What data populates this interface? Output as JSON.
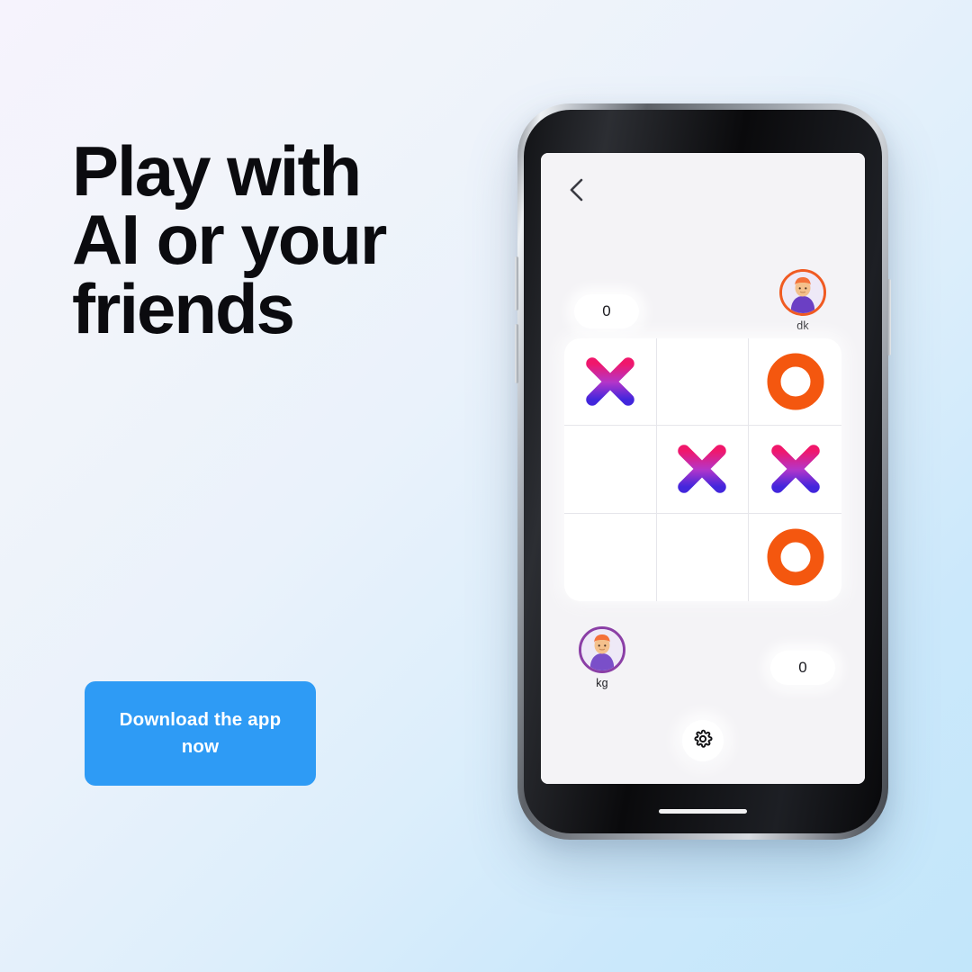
{
  "promo": {
    "headline": "Play with\nAI or your\nfriends",
    "cta_label": "Download the app now",
    "cta_color": "#2e9bf5",
    "background_from": "#f6f3fd",
    "background_to": "#c2e6fa"
  },
  "app": {
    "back_icon": "chevron-left-icon",
    "settings_icon": "gear-icon",
    "screen_background": "#f4f3f6",
    "mark_x_gradient_from": "#f0176b",
    "mark_x_gradient_to": "#4226dc",
    "mark_o_color": "#f4570f",
    "players": {
      "top": {
        "name": "dk",
        "score": "0",
        "ring_color": "#f05a22",
        "avatar_icon": "avatar-orange-hair-icon"
      },
      "bottom": {
        "name": "kg",
        "score": "0",
        "ring_color": "#8b3fa6",
        "avatar_icon": "avatar-orange-hair-icon"
      }
    },
    "board": {
      "cells": [
        {
          "mark": "X"
        },
        {
          "mark": ""
        },
        {
          "mark": "O"
        },
        {
          "mark": ""
        },
        {
          "mark": "X"
        },
        {
          "mark": "X"
        },
        {
          "mark": ""
        },
        {
          "mark": ""
        },
        {
          "mark": "O"
        }
      ]
    }
  }
}
